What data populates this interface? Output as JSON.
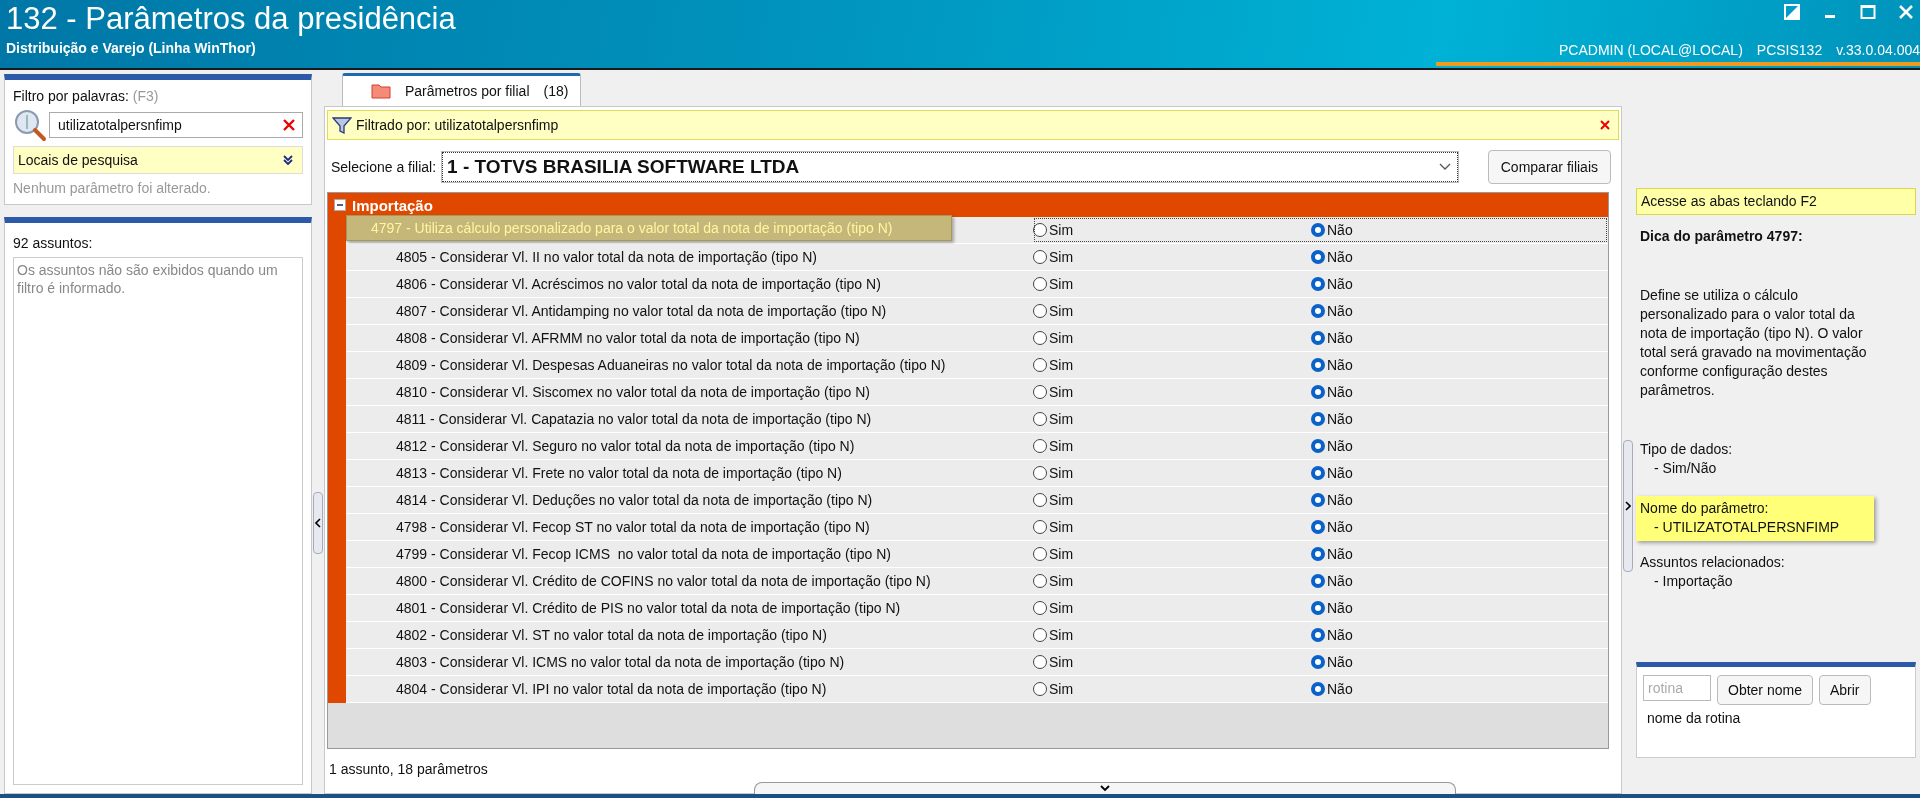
{
  "window": {
    "title": "132 - Parâmetros da presidência",
    "subtitle": "Distribuição e Varejo (Linha WinThor)",
    "user": "PCADMIN (LOCAL@LOCAL)",
    "routine": "PCSIS132",
    "version": "v.33.0.04.004"
  },
  "filter": {
    "label": "Filtro por palavras:",
    "shortcut": "(F3)",
    "value": "utilizatotalpersnfimp",
    "search_places": "Locais de pesquisa",
    "status": "Nenhum parâmetro foi alterado."
  },
  "subjects": {
    "count_label": "92 assuntos:",
    "message": "Os assuntos não são exibidos quando um filtro é informado."
  },
  "tabs": [
    {
      "label": "Parâmetros por filial",
      "count": "(18)",
      "selected": true
    }
  ],
  "filtered_by": "Filtrado por: utilizatotalpersnfimp",
  "branch": {
    "label": "Selecione a filial:",
    "value": "1 - TOTVS BRASILIA SOFTWARE LTDA"
  },
  "compare_button": "Comparar filiais",
  "group": {
    "title": "Importação",
    "expanded": true,
    "rows": [
      {
        "label": "4797 - Utiliza cálculo personalizado para o valor total da nota de importação (tipo N)",
        "selected": true,
        "options": [
          {
            "label": "Sim",
            "selected": false
          },
          {
            "label": "Não",
            "selected": true
          }
        ]
      },
      {
        "label": "4805 - Considerar Vl. II no valor total da nota de importação (tipo N)",
        "selected": false,
        "options": [
          {
            "label": "Sim",
            "selected": false
          },
          {
            "label": "Não",
            "selected": true
          }
        ]
      },
      {
        "label": "4806 - Considerar Vl. Acréscimos no valor total da nota de importação (tipo N)",
        "selected": false,
        "options": [
          {
            "label": "Sim",
            "selected": false
          },
          {
            "label": "Não",
            "selected": true
          }
        ]
      },
      {
        "label": "4807 - Considerar Vl. Antidamping no valor total da nota de importação (tipo N)",
        "selected": false,
        "options": [
          {
            "label": "Sim",
            "selected": false
          },
          {
            "label": "Não",
            "selected": true
          }
        ]
      },
      {
        "label": "4808 - Considerar Vl. AFRMM no valor total da nota de importação (tipo N)",
        "selected": false,
        "options": [
          {
            "label": "Sim",
            "selected": false
          },
          {
            "label": "Não",
            "selected": true
          }
        ]
      },
      {
        "label": "4809 - Considerar Vl. Despesas Aduaneiras no valor total da nota de importação (tipo N)",
        "selected": false,
        "options": [
          {
            "label": "Sim",
            "selected": false
          },
          {
            "label": "Não",
            "selected": true
          }
        ]
      },
      {
        "label": "4810 - Considerar Vl. Siscomex no valor total da nota de importação (tipo N)",
        "selected": false,
        "options": [
          {
            "label": "Sim",
            "selected": false
          },
          {
            "label": "Não",
            "selected": true
          }
        ]
      },
      {
        "label": "4811 - Considerar Vl. Capatazia no valor total da nota de importação (tipo N)",
        "selected": false,
        "options": [
          {
            "label": "Sim",
            "selected": false
          },
          {
            "label": "Não",
            "selected": true
          }
        ]
      },
      {
        "label": "4812 - Considerar Vl. Seguro no valor total da nota de importação (tipo N)",
        "selected": false,
        "options": [
          {
            "label": "Sim",
            "selected": false
          },
          {
            "label": "Não",
            "selected": true
          }
        ]
      },
      {
        "label": "4813 - Considerar Vl. Frete no valor total da nota de importação (tipo N)",
        "selected": false,
        "options": [
          {
            "label": "Sim",
            "selected": false
          },
          {
            "label": "Não",
            "selected": true
          }
        ]
      },
      {
        "label": "4814 - Considerar Vl. Deduções no valor total da nota de importação (tipo N)",
        "selected": false,
        "options": [
          {
            "label": "Sim",
            "selected": false
          },
          {
            "label": "Não",
            "selected": true
          }
        ]
      },
      {
        "label": "4798 - Considerar Vl. Fecop ST no valor total da nota de importação (tipo N)",
        "selected": false,
        "options": [
          {
            "label": "Sim",
            "selected": false
          },
          {
            "label": "Não",
            "selected": true
          }
        ]
      },
      {
        "label": "4799 - Considerar Vl. Fecop ICMS  no valor total da nota de importação (tipo N)",
        "selected": false,
        "options": [
          {
            "label": "Sim",
            "selected": false
          },
          {
            "label": "Não",
            "selected": true
          }
        ]
      },
      {
        "label": "4800 - Considerar Vl. Crédito de COFINS no valor total da nota de importação (tipo N)",
        "selected": false,
        "options": [
          {
            "label": "Sim",
            "selected": false
          },
          {
            "label": "Não",
            "selected": true
          }
        ]
      },
      {
        "label": "4801 - Considerar Vl. Crédito de PIS no valor total da nota de importação (tipo N)",
        "selected": false,
        "options": [
          {
            "label": "Sim",
            "selected": false
          },
          {
            "label": "Não",
            "selected": true
          }
        ]
      },
      {
        "label": "4802 - Considerar Vl. ST no valor total da nota de importação (tipo N)",
        "selected": false,
        "options": [
          {
            "label": "Sim",
            "selected": false
          },
          {
            "label": "Não",
            "selected": true
          }
        ]
      },
      {
        "label": "4803 - Considerar Vl. ICMS no valor total da nota de importação (tipo N)",
        "selected": false,
        "options": [
          {
            "label": "Sim",
            "selected": false
          },
          {
            "label": "Não",
            "selected": true
          }
        ]
      },
      {
        "label": "4804 - Considerar Vl. IPI no valor total da nota de importação (tipo N)",
        "selected": false,
        "options": [
          {
            "label": "Sim",
            "selected": false
          },
          {
            "label": "Não",
            "selected": true
          }
        ]
      }
    ]
  },
  "summary": "1 assunto, 18 parâmetros",
  "hint": {
    "shortcut_note": "Acesse as abas teclando F2",
    "title": "Dica do parâmetro 4797:",
    "description": "Define se utiliza o cálculo personalizado para o valor total da nota de importação (tipo N). O valor total será gravado na movimentação conforme configuração destes parâmetros.",
    "data_type_label": "Tipo de dados:",
    "data_type": "- Sim/Não",
    "name_label": "Nome do parâmetro:",
    "name": "- UTILIZATOTALPERSNFIMP",
    "subjects_label": "Assuntos relacionados:",
    "subjects": [
      "- Importação"
    ]
  },
  "routine": {
    "placeholder": "rotina",
    "get_name_button": "Obter nome",
    "open_button": "Abrir",
    "name_text": "nome da rotina"
  }
}
